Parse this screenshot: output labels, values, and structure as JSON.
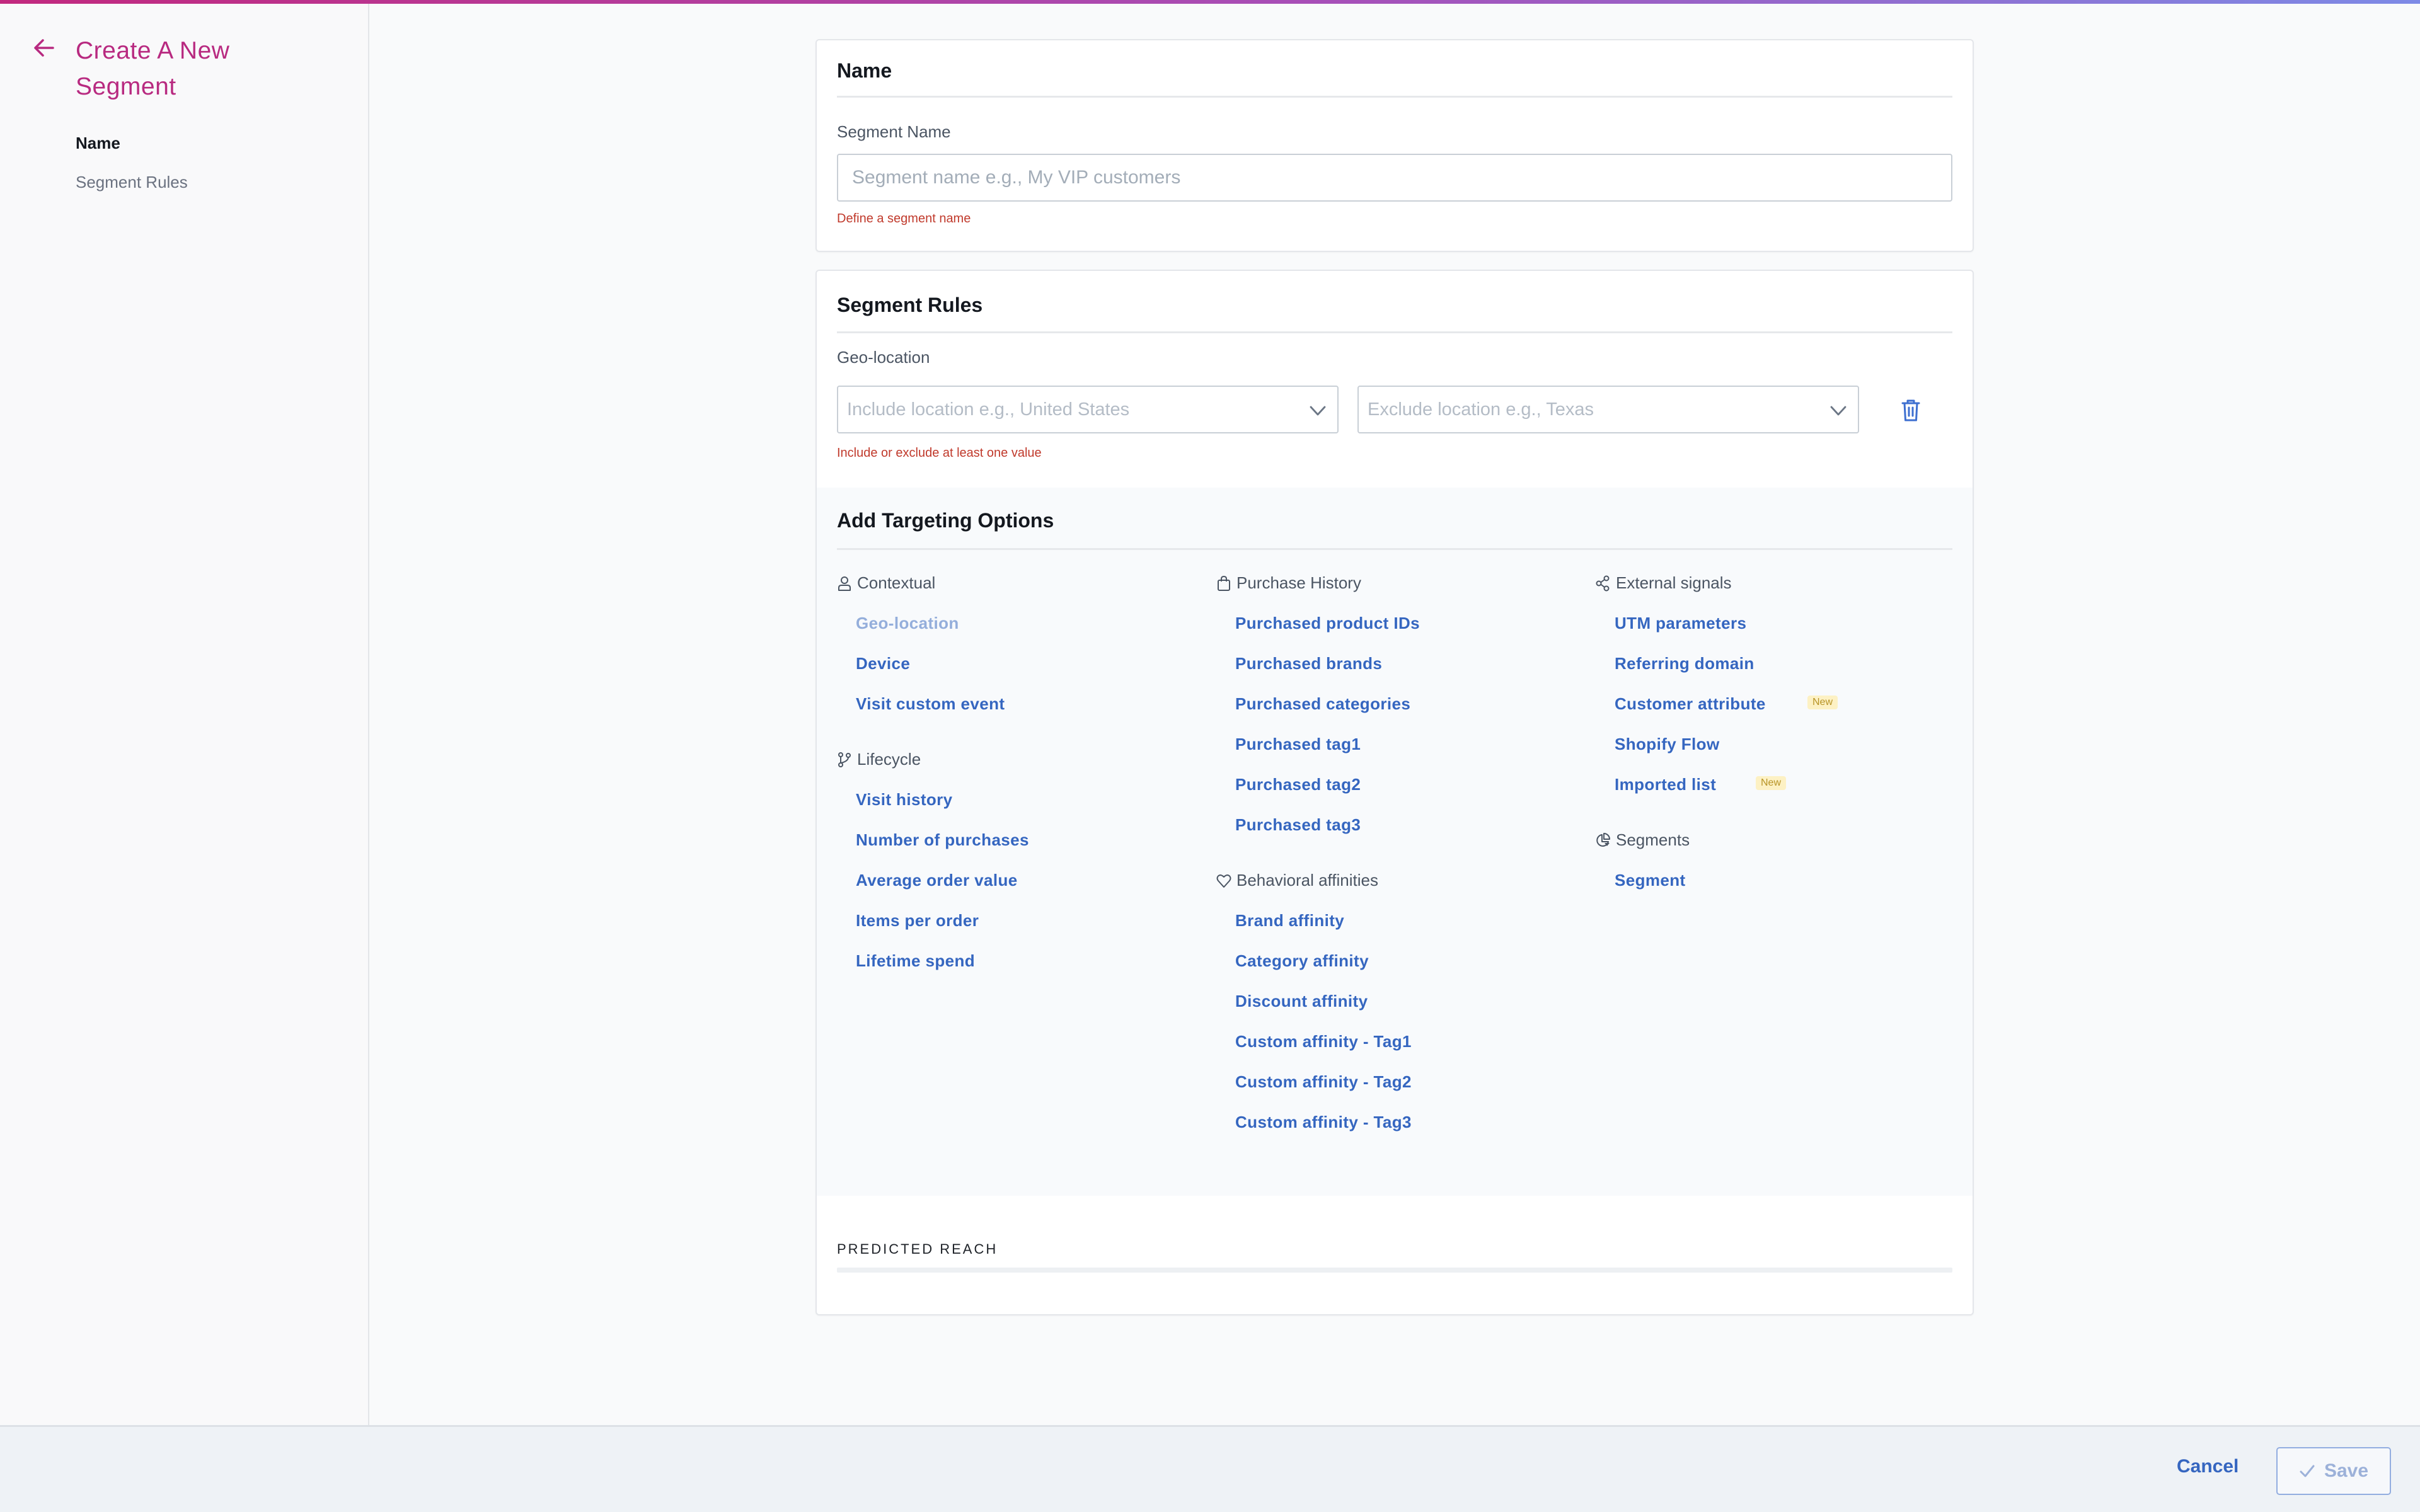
{
  "colors": {
    "brand": "#b82a80",
    "link": "#3566c0",
    "link_disabled": "#94aedb",
    "error": "#c0392b",
    "badge_bg": "#fdf1c4",
    "badge_text": "#b89426"
  },
  "sidebar": {
    "back_icon": "arrow-left-icon",
    "title": "Create A New Segment",
    "items": [
      {
        "label": "Name",
        "active": true
      },
      {
        "label": "Segment Rules",
        "active": false
      }
    ]
  },
  "name_card": {
    "title": "Name",
    "field_label": "Segment Name",
    "input_value": "",
    "input_placeholder": "Segment name e.g., My VIP customers",
    "error": "Define a segment name"
  },
  "rules_card": {
    "title": "Segment Rules",
    "rule": {
      "label": "Geo-location",
      "include_placeholder": "Include location e.g., United States",
      "exclude_placeholder": "Exclude location e.g., Texas",
      "delete_icon": "trash-icon",
      "error": "Include or exclude at least one value"
    },
    "targeting": {
      "title": "Add Targeting Options",
      "columns": [
        {
          "groups": [
            {
              "label": "Contextual",
              "icon": "user-icon",
              "options": [
                {
                  "label": "Geo-location",
                  "disabled": true
                },
                {
                  "label": "Device"
                },
                {
                  "label": "Visit custom event"
                }
              ]
            },
            {
              "label": "Lifecycle",
              "icon": "branch-icon",
              "options": [
                {
                  "label": "Visit history"
                },
                {
                  "label": "Number of purchases"
                },
                {
                  "label": "Average order value"
                },
                {
                  "label": "Items per order"
                },
                {
                  "label": "Lifetime spend"
                }
              ]
            }
          ]
        },
        {
          "groups": [
            {
              "label": "Purchase History",
              "icon": "shopping-bag-icon",
              "options": [
                {
                  "label": "Purchased product IDs"
                },
                {
                  "label": "Purchased brands"
                },
                {
                  "label": "Purchased categories"
                },
                {
                  "label": "Purchased tag1"
                },
                {
                  "label": "Purchased tag2"
                },
                {
                  "label": "Purchased tag3"
                }
              ]
            },
            {
              "label": "Behavioral affinities",
              "icon": "heart-icon",
              "options": [
                {
                  "label": "Brand affinity"
                },
                {
                  "label": "Category affinity"
                },
                {
                  "label": "Discount affinity"
                },
                {
                  "label": "Custom affinity - Tag1"
                },
                {
                  "label": "Custom affinity - Tag2"
                },
                {
                  "label": "Custom affinity - Tag3"
                }
              ]
            }
          ]
        },
        {
          "groups": [
            {
              "label": "External signals",
              "icon": "share-icon",
              "options": [
                {
                  "label": "UTM parameters"
                },
                {
                  "label": "Referring domain"
                },
                {
                  "label": "Customer attribute",
                  "badge": "New"
                },
                {
                  "label": "Shopify Flow"
                },
                {
                  "label": "Imported list",
                  "badge": "New"
                }
              ]
            },
            {
              "label": "Segments",
              "icon": "pie-chart-icon",
              "options": [
                {
                  "label": "Segment"
                }
              ]
            }
          ]
        }
      ]
    },
    "predicted_reach": {
      "label": "PREDICTED REACH",
      "fraction": 0
    }
  },
  "footer": {
    "cancel_label": "Cancel",
    "save_label": "Save",
    "save_icon": "check-icon"
  }
}
